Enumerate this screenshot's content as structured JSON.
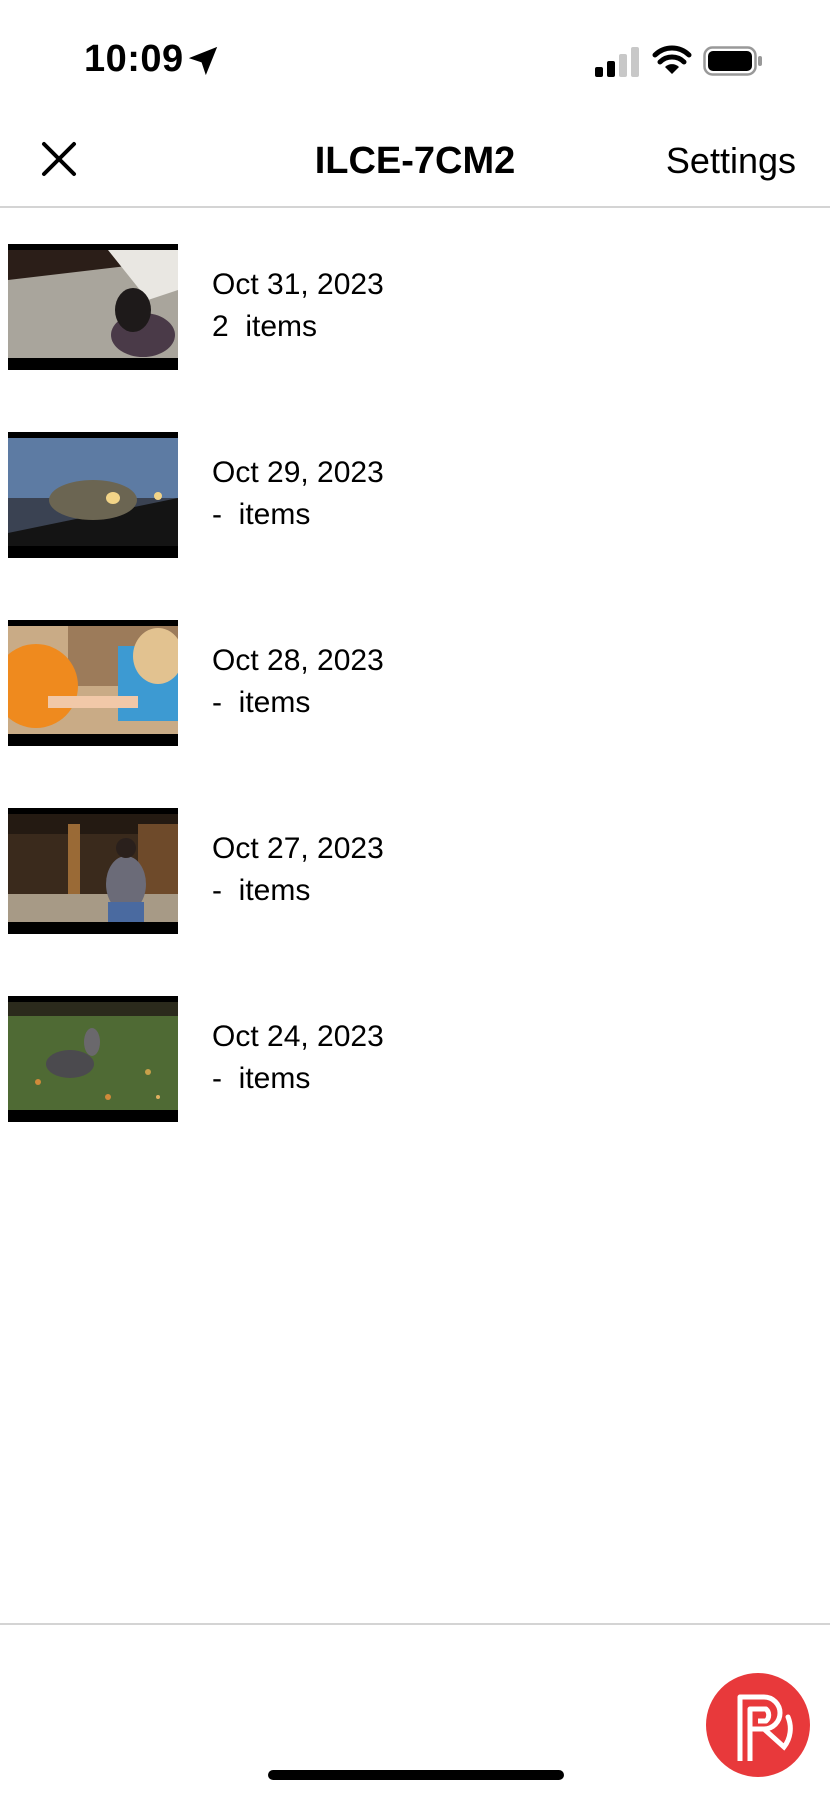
{
  "status_bar": {
    "time": "10:09",
    "icons": [
      "location-arrow-icon",
      "signal-icon",
      "wifi-icon",
      "battery-icon"
    ]
  },
  "nav": {
    "title": "ILCE-7CM2",
    "settings_label": "Settings",
    "close_icon": "close-icon"
  },
  "items": [
    {
      "date": "Oct 31, 2023",
      "count": "2  items",
      "thumbnail": "carpet-floor-photo"
    },
    {
      "date": "Oct 29, 2023",
      "count": "-  items",
      "thumbnail": "car-side-mirror-photo"
    },
    {
      "date": "Oct 28, 2023",
      "count": "-  items",
      "thumbnail": "pumpkin-carving-photo"
    },
    {
      "date": "Oct 27, 2023",
      "count": "-  items",
      "thumbnail": "person-indoors-photo"
    },
    {
      "date": "Oct 24, 2023",
      "count": "-  items",
      "thumbnail": "dog-on-grass-photo"
    }
  ],
  "footer": {
    "logo_icon": "app-logo-icon",
    "brand_color": "#e8393b"
  }
}
